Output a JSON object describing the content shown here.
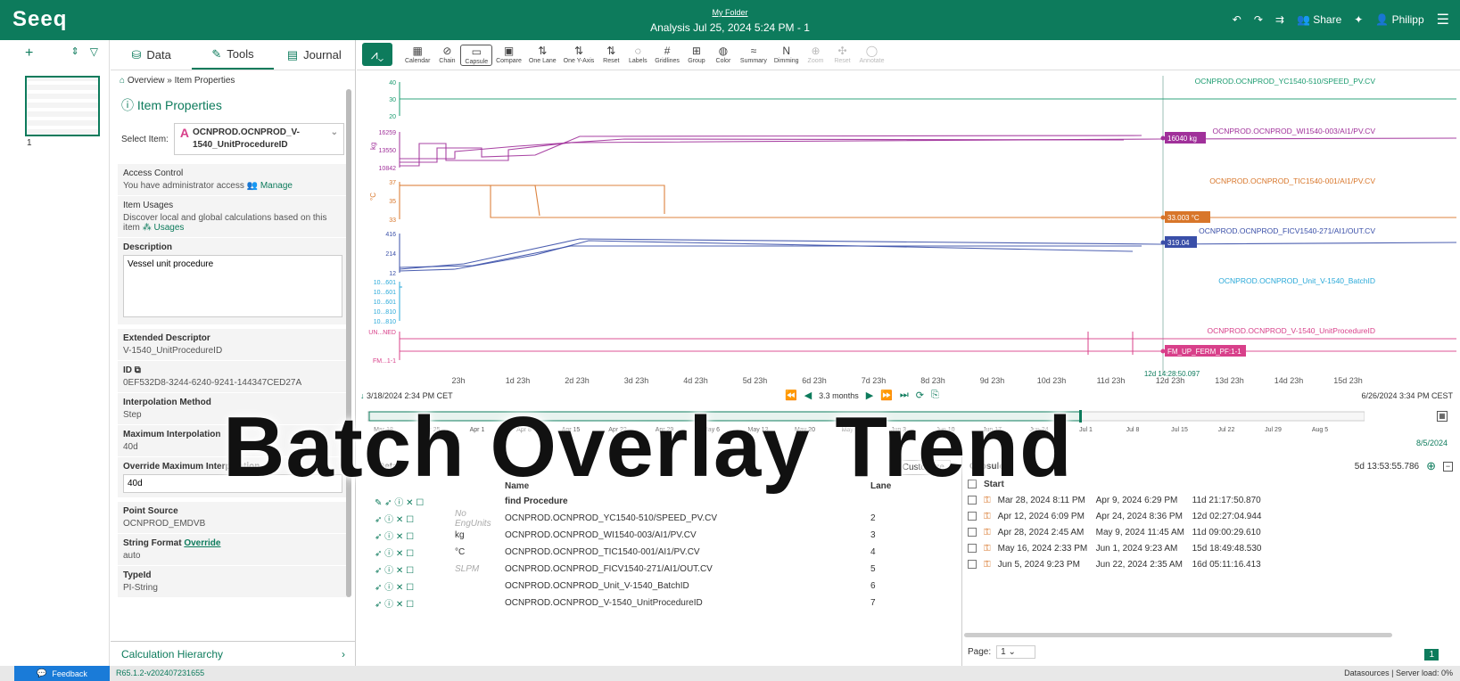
{
  "header": {
    "logo": "Seeq",
    "folder": "My Folder",
    "title": "Analysis Jul 25, 2024 5:24 PM - 1",
    "share": "Share",
    "user": "Philipp"
  },
  "rail": {
    "page_number": "1"
  },
  "panel": {
    "tabs": [
      "Data",
      "Tools",
      "Journal"
    ],
    "breadcrumb": "Overview » Item Properties",
    "title": "Item Properties",
    "select_label": "Select Item:",
    "selected_item": "OCNPROD.OCNPROD_V-1540_UnitProcedureID",
    "access_label": "Access Control",
    "access_text": "You have administrator access",
    "manage": "Manage",
    "usages_label": "Item Usages",
    "usages_text": "Discover local and global calculations based on this item",
    "usages_link": "Usages",
    "desc_label": "Description",
    "desc_value": "Vessel unit procedure",
    "ext_label": "Extended Descriptor",
    "ext_value": "V-1540_UnitProcedureID",
    "id_label": "ID",
    "id_value": "0EF532D8-3244-6240-9241-144347CED27A",
    "interp_label": "Interpolation Method",
    "interp_value": "Step",
    "maxinterp_label": "Maximum Interpolation",
    "maxinterp_value": "40d",
    "override_label": "Override Maximum Interpolation",
    "override_value": "40d",
    "ps_label": "Point Source",
    "ps_value": "OCNPROD_EMDVB",
    "sf_label": "String Format",
    "sf_link": "Override",
    "sf_value": "auto",
    "type_label": "TypeId",
    "type_value": "PI-String",
    "calc": "Calculation Hierarchy"
  },
  "toolbar": [
    "Calendar",
    "Chain",
    "Capsule",
    "Compare",
    "One Lane",
    "One Y-Axis",
    "Reset",
    "Labels",
    "Gridlines",
    "Group",
    "Color",
    "Summary",
    "Dimming",
    "Zoom",
    "Reset",
    "Annotate"
  ],
  "chart_data": {
    "type": "line",
    "x_ticks": [
      "23h",
      "1d 23h",
      "2d 23h",
      "3d 23h",
      "4d 23h",
      "5d 23h",
      "6d 23h",
      "7d 23h",
      "8d 23h",
      "9d 23h",
      "10d 23h",
      "11d 23h",
      "12d 23h",
      "13d 23h",
      "14d 23h",
      "15d 23h"
    ],
    "cursor_label": "12d 14:28:50.097",
    "series": [
      {
        "name": "OCNPROD.OCNPROD_YC1540-510/SPEED_PV.CV",
        "color": "#1a9b6f",
        "ticks": [
          "40",
          "30",
          "20"
        ]
      },
      {
        "name": "OCNPROD.OCNPROD_WI1540-003/AI1/PV.CV",
        "color": "#a0309a",
        "ticks": [
          "16259",
          "13550",
          "10842"
        ],
        "unit": "kg",
        "cursor_value": "16040 kg"
      },
      {
        "name": "OCNPROD.OCNPROD_TIC1540-001/AI1/PV.CV",
        "color": "#d8762a",
        "ticks": [
          "37",
          "35",
          "33"
        ],
        "unit": "°C",
        "cursor_value": "33.003 °C"
      },
      {
        "name": "OCNPROD.OCNPROD_FICV1540-271/AI1/OUT.CV",
        "color": "#3a4fa8",
        "ticks": [
          "416",
          "214",
          "12"
        ],
        "cursor_value": "319.04"
      },
      {
        "name": "OCNPROD.OCNPROD_Unit_V-1540_BatchID",
        "color": "#28a8d8",
        "ticks": [
          "10...601",
          "10...601",
          "10...601",
          "10...810",
          "10...810"
        ]
      },
      {
        "name": "OCNPROD.OCNPROD_V-1540_UnitProcedureID",
        "color": "#d8408a",
        "ticks": [
          "UN...NED",
          "FM...1-1"
        ],
        "cursor_value": "FM_UP_FERM_PF:1-1"
      }
    ]
  },
  "nav": {
    "start": "3/18/2024 2:34 PM CET",
    "end": "6/26/2024 3:34 PM CEST",
    "range": "3.3 months"
  },
  "overview": {
    "ticks": [
      "Mar 18",
      "Mar 25",
      "Apr 1",
      "Apr 8",
      "Apr 15",
      "Apr 22",
      "Apr 29",
      "May 6",
      "May 13",
      "May 20",
      "May 27",
      "Jun 3",
      "Jun 10",
      "Jun 17",
      "Jun 24",
      "Jul 1",
      "Jul 8",
      "Jul 15",
      "Jul 22",
      "Jul 29",
      "Aug 5"
    ],
    "end": "8/5/2024"
  },
  "details": {
    "title": "Details",
    "customize": "Customize",
    "name_col": "Name",
    "lane_col": "Lane",
    "rows": [
      {
        "unit": "",
        "name": "find Procedure",
        "lane": ""
      },
      {
        "unit": "No EngUnits",
        "name": "OCNPROD.OCNPROD_YC1540-510/SPEED_PV.CV",
        "lane": "2"
      },
      {
        "unit": "kg",
        "name": "OCNPROD.OCNPROD_WI1540-003/AI1/PV.CV",
        "lane": "3"
      },
      {
        "unit": "°C",
        "name": "OCNPROD.OCNPROD_TIC1540-001/AI1/PV.CV",
        "lane": "4"
      },
      {
        "unit": "SLPM",
        "name": "OCNPROD.OCNPROD_FICV1540-271/AI1/OUT.CV",
        "lane": "5"
      },
      {
        "unit": "",
        "name": "OCNPROD.OCNPROD_Unit_V-1540_BatchID",
        "lane": "6"
      },
      {
        "unit": "",
        "name": "OCNPROD.OCNPROD_V-1540_UnitProcedureID",
        "lane": "7"
      }
    ]
  },
  "capsules": {
    "title": "Capsules",
    "duration": "5d 13:53:55.786",
    "start_col": "Start",
    "rows": [
      {
        "start": "Mar 28, 2024 8:11 PM",
        "end": "Apr 9, 2024 6:29 PM",
        "dur": "11d 21:17:50.870"
      },
      {
        "start": "Apr 12, 2024 6:09 PM",
        "end": "Apr 24, 2024 8:36 PM",
        "dur": "12d 02:27:04.944"
      },
      {
        "start": "Apr 28, 2024 2:45 AM",
        "end": "May 9, 2024 11:45 AM",
        "dur": "11d 09:00:29.610"
      },
      {
        "start": "May 16, 2024 2:33 PM",
        "end": "Jun 1, 2024 9:23 AM",
        "dur": "15d 18:49:48.530"
      },
      {
        "start": "Jun 5, 2024 9:23 PM",
        "end": "Jun 22, 2024 2:35 AM",
        "dur": "16d 05:11:16.413"
      }
    ],
    "page_label": "Page:",
    "page_value": "1",
    "page_num": "1"
  },
  "footer": {
    "feedback": "Feedback",
    "version": "R65.1.2-v202407231655",
    "status": "Datasources | Server load: 0%"
  },
  "overlay_text": "Batch Overlay Trend"
}
